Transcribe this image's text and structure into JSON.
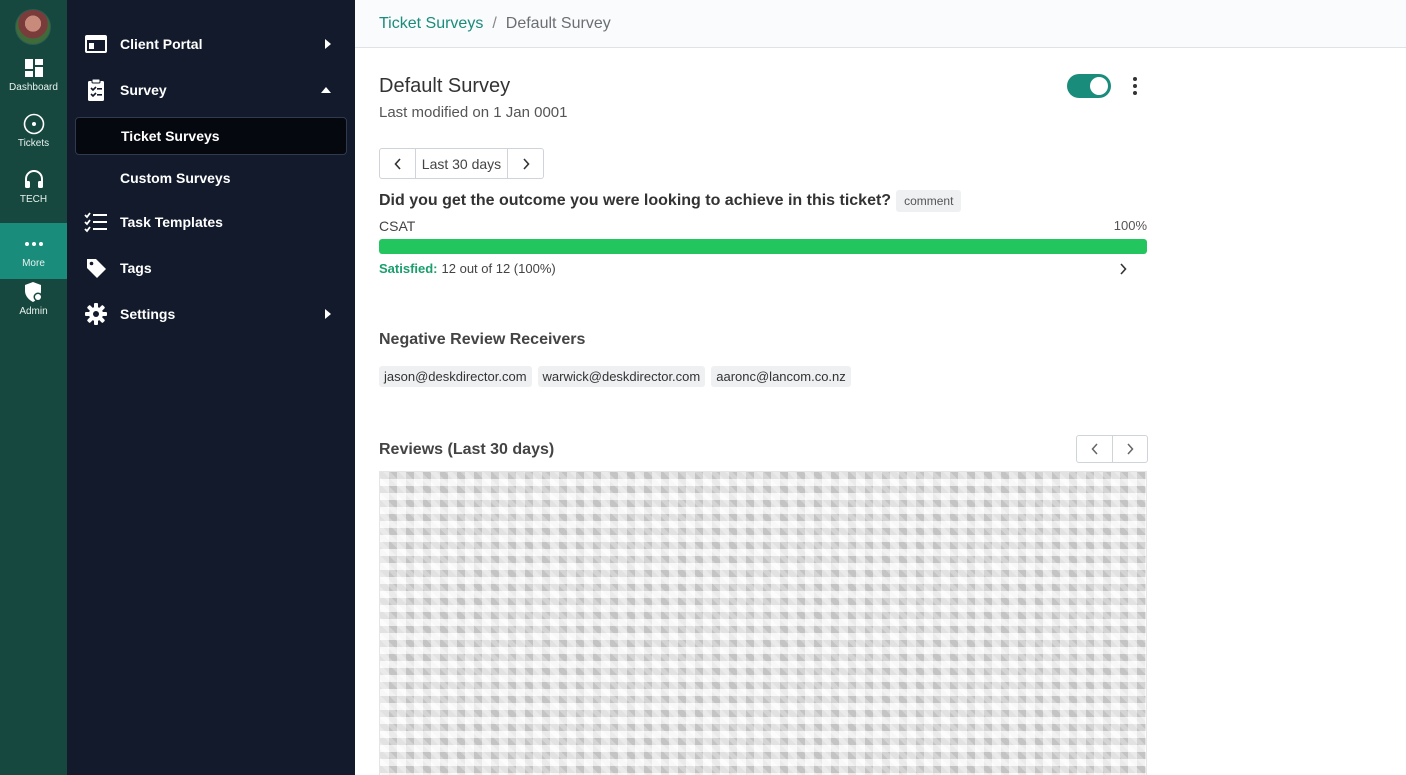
{
  "rail": {
    "items": [
      {
        "label": "Dashboard",
        "icon": "dashboard-icon"
      },
      {
        "label": "Tickets",
        "icon": "tickets-icon"
      },
      {
        "label": "TECH",
        "icon": "headset-icon"
      },
      {
        "label": "More",
        "icon": "more-dots-icon"
      },
      {
        "label": "Admin",
        "icon": "admin-shield-icon"
      }
    ]
  },
  "nav": {
    "items": [
      {
        "label": "Client Portal",
        "icon": "portal-icon"
      },
      {
        "label": "Survey",
        "icon": "clipboard-icon"
      },
      {
        "label": "Ticket Surveys"
      },
      {
        "label": "Custom Surveys"
      },
      {
        "label": "Task Templates",
        "icon": "checklist-icon"
      },
      {
        "label": "Tags",
        "icon": "tag-icon"
      },
      {
        "label": "Settings",
        "icon": "gear-icon"
      }
    ]
  },
  "breadcrumb": {
    "parent": "Ticket Surveys",
    "separator": "/",
    "current": "Default Survey"
  },
  "survey": {
    "title": "Default Survey",
    "modified": "Last modified on 1 Jan 0001",
    "enabled": true,
    "range_label": "Last 30 days"
  },
  "question": {
    "text": "Did you get the outcome you were looking to achieve in this ticket?",
    "tag": "comment",
    "metric_label": "CSAT",
    "metric_pct": "100%",
    "fill_fraction": 1.0,
    "satisfied_key": "Satisfied:",
    "satisfied_value": "12 out of 12 (100%)"
  },
  "receivers": {
    "title": "Negative Review Receivers",
    "emails": [
      "jason@deskdirector.com",
      "warwick@deskdirector.com",
      "aaronc@lancom.co.nz"
    ]
  },
  "reviews": {
    "title": "Reviews (Last 30 days)"
  },
  "colors": {
    "rail_bg": "#17483f",
    "nav_bg": "#121a2b",
    "accent": "#1a8c7b",
    "success": "#22c55e"
  }
}
